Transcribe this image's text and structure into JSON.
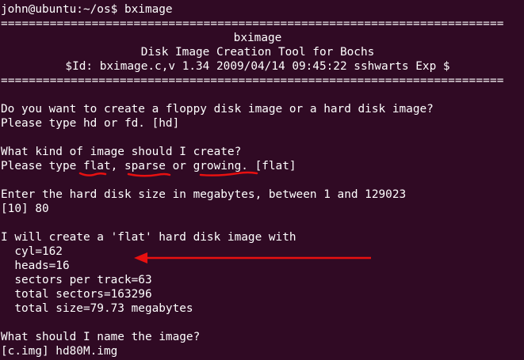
{
  "terminal": {
    "lines": {
      "prompt": "john@ubuntu:~/os$ bximage",
      "rule_top": "========================================================================",
      "title": "bximage",
      "subtitle": "Disk Image Creation Tool for Bochs",
      "id_line": "$Id: bximage.c,v 1.34 2009/04/14 09:45:22 sshwarts Exp $",
      "rule_bottom": "========================================================================",
      "q_disk_type": "Do you want to create a floppy disk image or a hard disk image?",
      "q_disk_type_hint": "Please type hd or fd. [hd]",
      "q_image_kind": "What kind of image should I create?",
      "q_image_kind_hint": "Please type flat, sparse or growing. [flat]",
      "q_size": "Enter the hard disk size in megabytes, between 1 and 129023",
      "a_size": "[10] 80",
      "info_header": "I will create a 'flat' hard disk image with",
      "cyl": "  cyl=162",
      "heads": "  heads=16",
      "sectors_per_track": "  sectors per track=63",
      "total_sectors": "  total sectors=163296",
      "total_size": "  total size=79.73 megabytes",
      "q_name": "What should I name the image?",
      "a_name": "[c.img] hd80M.img"
    }
  },
  "annotations": {
    "ink_color": "#e81010"
  }
}
